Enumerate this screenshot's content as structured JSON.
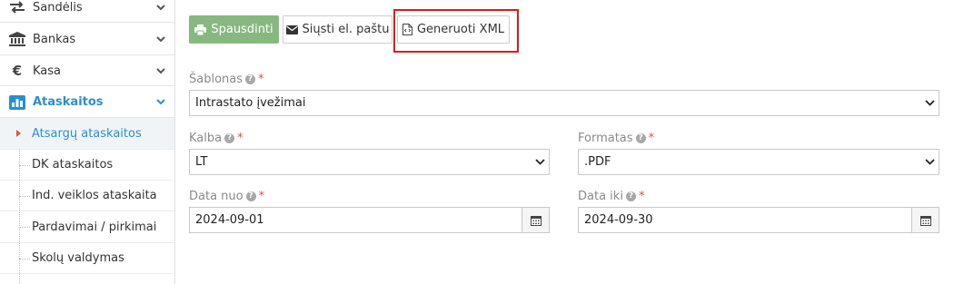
{
  "sidebar": {
    "items": [
      {
        "label": "Sandėlis",
        "icon": "arrows-exchange-icon"
      },
      {
        "label": "Bankas",
        "icon": "bank-icon"
      },
      {
        "label": "Kasa",
        "icon": "euro-icon"
      },
      {
        "label": "Ataskaitos",
        "icon": "chart-icon",
        "active": true
      }
    ],
    "subitems": [
      {
        "label": "Atsargų ataskaitos",
        "current": true
      },
      {
        "label": "DK ataskaitos"
      },
      {
        "label": "Ind. veiklos ataskaita"
      },
      {
        "label": "Pardavimai / pirkimai"
      },
      {
        "label": "Skolų valdymas"
      }
    ]
  },
  "toolbar": {
    "print_label": "Spausdinti",
    "email_label": "Siųsti el. paštu",
    "xml_label": "Generuoti XML"
  },
  "form": {
    "template": {
      "label": "Šablonas",
      "value": "Intrastato įvežimai"
    },
    "language": {
      "label": "Kalba",
      "value": "LT"
    },
    "format": {
      "label": "Formatas",
      "value": ".PDF"
    },
    "date_from": {
      "label": "Data nuo",
      "value": "2024-09-01"
    },
    "date_to": {
      "label": "Data iki",
      "value": "2024-09-30"
    },
    "help_symbol": "?",
    "required_symbol": "*"
  },
  "colors": {
    "accent": "#2a8fcf",
    "print_button": "#87b87f",
    "highlight": "#dd1b1b",
    "required": "#d9534f"
  }
}
